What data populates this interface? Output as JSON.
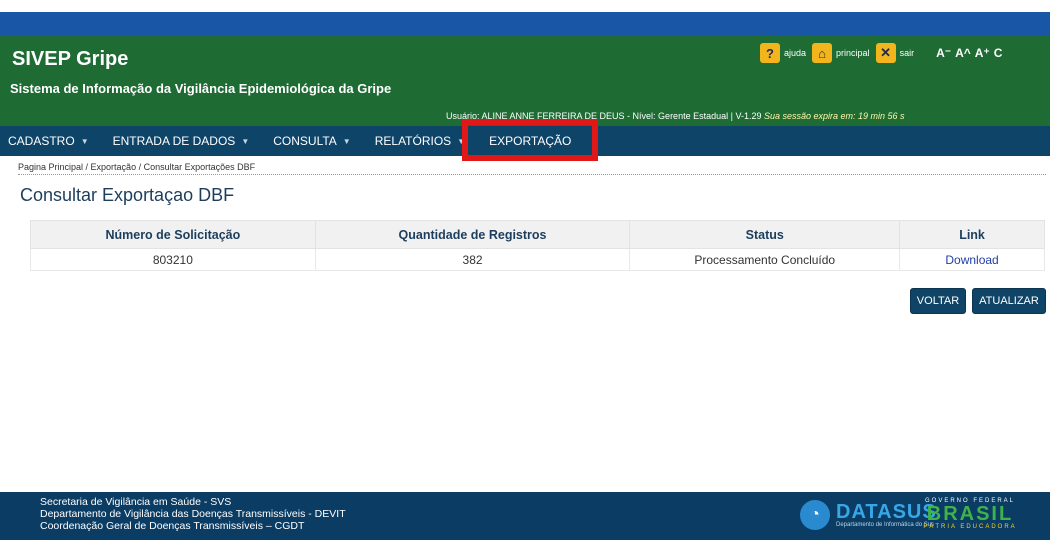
{
  "header": {
    "app_title": "SIVEP Gripe",
    "subtitle": "Sistema de Informação da Vigilância Epidemiológica da Gripe",
    "user_info": "Usuário: ALINE ANNE FERREIRA DE DEUS  -  Nível: Gerente Estadual  |  V-1.29",
    "session_info": "Sua sessão expira em: 19 min 56 s",
    "tools": {
      "help_label": "ajuda",
      "home_label": "principal",
      "exit_label": "sair",
      "help_icon": "?",
      "home_icon": "⌂",
      "exit_icon": "✕"
    },
    "font_controls": [
      "A⁻",
      "A^",
      "A⁺",
      "C"
    ]
  },
  "nav": {
    "items": [
      {
        "label": "CADASTRO",
        "has_dropdown": true
      },
      {
        "label": "ENTRADA DE DADOS",
        "has_dropdown": true
      },
      {
        "label": "CONSULTA",
        "has_dropdown": true
      },
      {
        "label": "RELATÓRIOS",
        "has_dropdown": true
      },
      {
        "label": "EXPORTAÇÃO",
        "has_dropdown": false
      }
    ],
    "caret": "▼"
  },
  "breadcrumb": "Pagina Principal / Exportação / Consultar Exportações DBF",
  "page_title": "Consultar Exportaçao DBF",
  "table": {
    "columns": [
      "Número de Solicitação",
      "Quantidade de Registros",
      "Status",
      "Link"
    ],
    "rows": [
      {
        "numero": "803210",
        "quantidade": "382",
        "status": "Processamento Concluído",
        "link": "Download"
      }
    ]
  },
  "buttons": {
    "voltar": "VOLTAR",
    "atualizar": "ATUALIZAR"
  },
  "footer": {
    "lines": [
      "Secretaria de Vigilância em Saúde - SVS",
      "Departamento de Vigilância das Doenças Transmissíveis - DEVIT",
      "Coordenação Geral de Doenças Transmissíveis – CGDT"
    ],
    "datasus_name": "DATASUS",
    "datasus_sub": "Departamento de Informática do Sus",
    "brasil_top": "GOVERNO FEDERAL",
    "brasil_word": "BRASIL",
    "brasil_bottom": "PÁTRIA EDUCADORA"
  },
  "colors": {
    "header_green": "#1e6b34",
    "nav_blue": "#0d4468",
    "highlight_red": "#e01818",
    "footer_blue": "#0b3c63"
  }
}
